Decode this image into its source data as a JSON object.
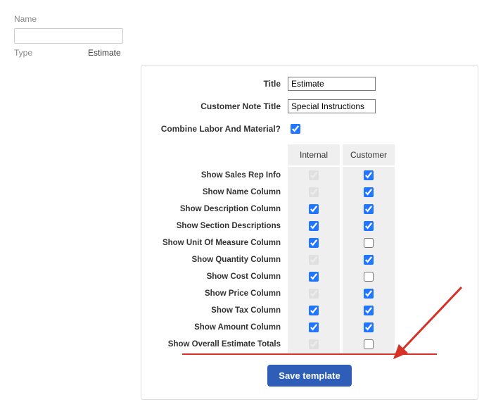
{
  "top": {
    "name_label": "Name",
    "name_value": "",
    "type_label": "Type",
    "type_value": "Estimate"
  },
  "form": {
    "title_label": "Title",
    "title_value": "Estimate",
    "note_label": "Customer Note Title",
    "note_value": "Special Instructions",
    "combine_label": "Combine Labor And Material?"
  },
  "cols": {
    "internal": "Internal",
    "customer": "Customer"
  },
  "rows": {
    "sales_rep": "Show Sales Rep Info",
    "name_col": "Show Name Column",
    "desc_col": "Show Description Column",
    "section_desc": "Show Section Descriptions",
    "uom": "Show Unit Of Measure Column",
    "qty": "Show Quantity Column",
    "cost": "Show Cost Column",
    "price": "Show Price Column",
    "tax": "Show Tax Column",
    "amount": "Show Amount Column",
    "totals": "Show Overall Estimate Totals"
  },
  "save_btn": "Save template"
}
